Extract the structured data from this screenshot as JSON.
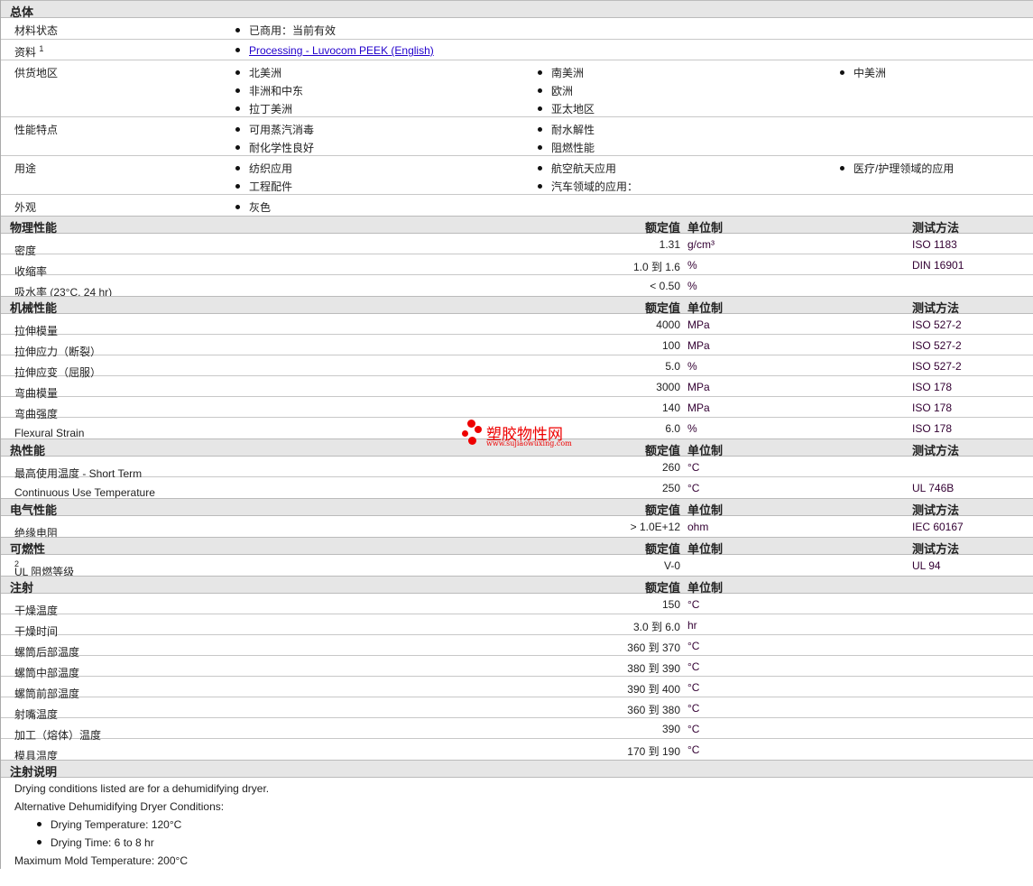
{
  "general": {
    "title": "总体",
    "status": {
      "label": "材料状态",
      "value": "已商用：当前有效"
    },
    "docs": {
      "label": "资料",
      "sup": "1",
      "link": "Processing - Luvocom PEEK (English)"
    },
    "regions": {
      "label": "供货地区",
      "items": [
        "北美洲",
        "南美洲",
        "中美洲",
        "非洲和中东",
        "欧洲",
        "拉丁美洲",
        "亚太地区"
      ]
    },
    "features": {
      "label": "性能特点",
      "items": [
        "可用蒸汽消毒",
        "耐水解性",
        "耐化学性良好",
        "阻燃性能"
      ]
    },
    "uses": {
      "label": "用途",
      "items": [
        "纺织应用",
        "航空航天应用",
        "医疗/护理领域的应用",
        "工程配件",
        "汽车领域的应用："
      ]
    },
    "appearance": {
      "label": "外观",
      "value": "灰色"
    }
  },
  "hdr": {
    "value": "额定值",
    "unit": "单位制",
    "method": "测试方法"
  },
  "physical": {
    "title": "物理性能",
    "rows": [
      {
        "name": "密度",
        "value": "1.31",
        "unit": "g/cm³",
        "method": "ISO 1183"
      },
      {
        "name": "收缩率",
        "value": "1.0 到  1.6",
        "unit": "%",
        "method": "DIN 16901"
      },
      {
        "name": "吸水率 (23°C, 24 hr)",
        "value": "< 0.50",
        "unit": "%",
        "method": ""
      }
    ]
  },
  "mechanical": {
    "title": "机械性能",
    "rows": [
      {
        "name": "拉伸模量",
        "value": "4000",
        "unit": "MPa",
        "method": "ISO 527-2"
      },
      {
        "name": "拉伸应力（断裂）",
        "value": "100",
        "unit": "MPa",
        "method": "ISO 527-2"
      },
      {
        "name": "拉伸应变（屈服）",
        "value": "5.0",
        "unit": "%",
        "method": "ISO 527-2"
      },
      {
        "name": "弯曲模量",
        "value": "3000",
        "unit": "MPa",
        "method": "ISO 178"
      },
      {
        "name": "弯曲强度",
        "value": "140",
        "unit": "MPa",
        "method": "ISO 178"
      },
      {
        "name": "Flexural Strain",
        "value": "6.0",
        "unit": "%",
        "method": "ISO 178"
      }
    ]
  },
  "thermal": {
    "title": "热性能",
    "rows": [
      {
        "name": "最高使用温度  - Short Term",
        "value": "260",
        "unit": "°C",
        "method": ""
      },
      {
        "name": "Continuous Use Temperature",
        "value": "250",
        "unit": "°C",
        "method": "UL 746B"
      }
    ]
  },
  "electrical": {
    "title": "电气性能",
    "rows": [
      {
        "name": "绝缘电阻",
        "value": "> 1.0E+12",
        "unit": "ohm",
        "method": "IEC 60167"
      }
    ]
  },
  "flammability": {
    "title": "可燃性",
    "rows": [
      {
        "name": "UL 阻燃等级",
        "sup": "2",
        "value": "V-0",
        "unit": "",
        "method": "UL 94"
      }
    ]
  },
  "injection": {
    "title": "注射",
    "rows": [
      {
        "name": "干燥温度",
        "value": "150",
        "unit": "°C"
      },
      {
        "name": "干燥时间",
        "value": "3.0 到  6.0",
        "unit": "hr"
      },
      {
        "name": "螺筒后部温度",
        "value": "360 到  370",
        "unit": "°C"
      },
      {
        "name": "螺筒中部温度",
        "value": "380 到  390",
        "unit": "°C"
      },
      {
        "name": "螺筒前部温度",
        "value": "390 到  400",
        "unit": "°C"
      },
      {
        "name": "射嘴温度",
        "value": "360 到  380",
        "unit": "°C"
      },
      {
        "name": "加工（熔体）温度",
        "value": "390",
        "unit": "°C"
      },
      {
        "name": "模具温度",
        "value": "170 到  190",
        "unit": "°C"
      }
    ]
  },
  "notes": {
    "title": "注射说明",
    "lines": [
      "Drying conditions listed are for a dehumidifying dryer.",
      "Alternative Dehumidifying Dryer Conditions:",
      "Drying Temperature: 120°C",
      "Drying Time: 6 to 8 hr",
      "Maximum Mold Temperature: 200°C"
    ]
  },
  "watermark": {
    "cn": "塑胶物性网",
    "en": "www.sujiaowuxing.com"
  }
}
